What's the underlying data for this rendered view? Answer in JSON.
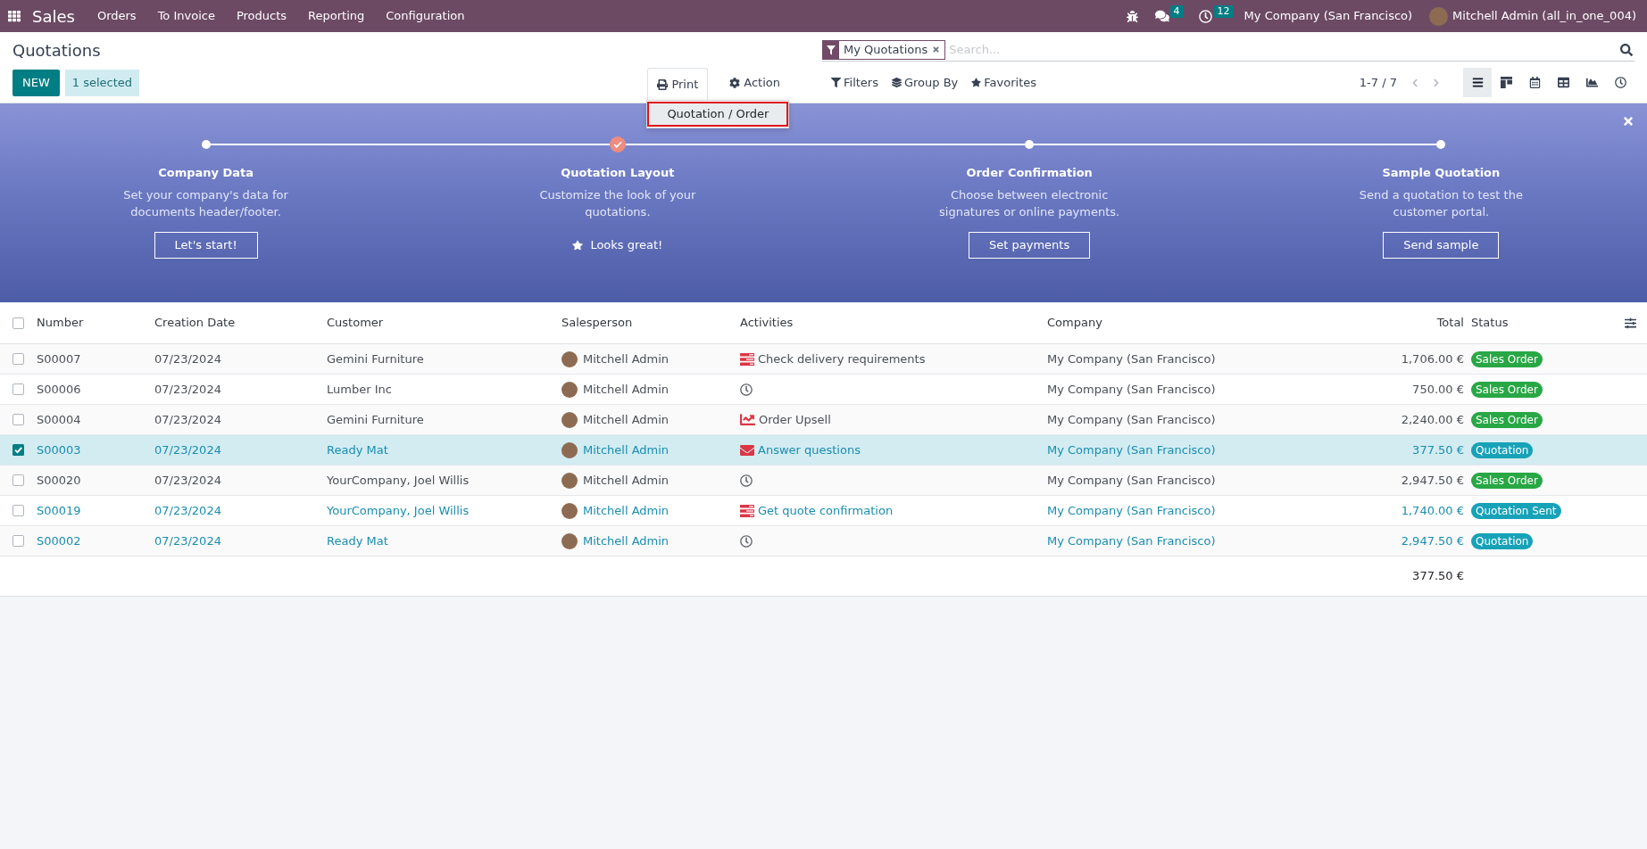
{
  "navbar": {
    "app_name": "Sales",
    "menu": [
      "Orders",
      "To Invoice",
      "Products",
      "Reporting",
      "Configuration"
    ],
    "systray": [
      {
        "kind": "bug"
      },
      {
        "kind": "chat",
        "badge": "4"
      },
      {
        "kind": "activity",
        "badge": "12"
      }
    ],
    "company": "My Company (San Francisco)",
    "user": "Mitchell Admin (all_in_one_004)"
  },
  "control_panel": {
    "title": "Quotations",
    "new_button": "NEW",
    "selection": "1 selected",
    "print_menu": {
      "label": "Print",
      "open": true,
      "items": [
        {
          "label": "Quotation / Order",
          "selected": true
        }
      ]
    },
    "action_menu": {
      "label": "Action"
    },
    "search": {
      "facets": [
        {
          "label": "My Quotations"
        }
      ],
      "placeholder": "Search..."
    },
    "filters": [
      {
        "kind": "filter",
        "label": "Filters"
      },
      {
        "kind": "group",
        "label": "Group By"
      },
      {
        "kind": "favorite",
        "label": "Favorites"
      }
    ],
    "pager": "1-7 / 7",
    "views": [
      {
        "kind": "list",
        "selected": true
      },
      {
        "kind": "kanban",
        "selected": false
      },
      {
        "kind": "calendar",
        "selected": false
      },
      {
        "kind": "pivot",
        "selected": false
      },
      {
        "kind": "graph",
        "selected": false
      },
      {
        "kind": "activity",
        "selected": false
      }
    ]
  },
  "banner": {
    "steps": [
      {
        "title": "Company Data",
        "description": [
          "Set your company's data for",
          "documents header/footer."
        ],
        "done": false,
        "action": "Let's start!"
      },
      {
        "title": "Quotation Layout",
        "description": [
          "Customize the look of your",
          "quotations."
        ],
        "done": true,
        "action": "Looks great!"
      },
      {
        "title": "Order Confirmation",
        "description": [
          "Choose between electronic",
          "signatures or online payments."
        ],
        "done": false,
        "action": "Set payments"
      },
      {
        "title": "Sample Quotation",
        "description": [
          "Send a quotation to test the",
          "customer portal."
        ],
        "done": false,
        "action": "Send sample"
      }
    ]
  },
  "table": {
    "all_selected": false,
    "columns": [
      "Number",
      "Creation Date",
      "Customer",
      "Salesperson",
      "Activities",
      "Company",
      "Total",
      "Status"
    ],
    "rows": [
      {
        "selected": false,
        "highlighted": false,
        "number": "S00007",
        "date": "07/23/2024",
        "customer": "Gemini Furniture",
        "salesperson": "Mitchell Admin",
        "activity": {
          "kind": "todo",
          "text": "Check delivery requirements"
        },
        "company": "My Company (San Francisco)",
        "total": "1,706.00 €",
        "status": {
          "label": "Sales Order",
          "color": "#28a745"
        }
      },
      {
        "selected": false,
        "highlighted": false,
        "number": "S00006",
        "date": "07/23/2024",
        "customer": "Lumber Inc",
        "salesperson": "Mitchell Admin",
        "activity": {
          "kind": "none"
        },
        "company": "My Company (San Francisco)",
        "total": "750.00 €",
        "status": {
          "label": "Sales Order",
          "color": "#28a745"
        }
      },
      {
        "selected": false,
        "highlighted": false,
        "number": "S00004",
        "date": "07/23/2024",
        "customer": "Gemini Furniture",
        "salesperson": "Mitchell Admin",
        "activity": {
          "kind": "upsell",
          "text": "Order Upsell"
        },
        "company": "My Company (San Francisco)",
        "total": "2,240.00 €",
        "status": {
          "label": "Sales Order",
          "color": "#28a745"
        }
      },
      {
        "selected": true,
        "highlighted": true,
        "number": "S00003",
        "date": "07/23/2024",
        "customer": "Ready Mat",
        "salesperson": "Mitchell Admin",
        "activity": {
          "kind": "email",
          "text": "Answer questions"
        },
        "company": "My Company (San Francisco)",
        "total": "377.50 €",
        "status": {
          "label": "Quotation",
          "color": "#17a2b8"
        }
      },
      {
        "selected": false,
        "highlighted": false,
        "number": "S00020",
        "date": "07/23/2024",
        "customer": "YourCompany, Joel Willis",
        "salesperson": "Mitchell Admin",
        "activity": {
          "kind": "none"
        },
        "company": "My Company (San Francisco)",
        "total": "2,947.50 €",
        "status": {
          "label": "Sales Order",
          "color": "#28a745"
        }
      },
      {
        "selected": false,
        "highlighted": true,
        "number": "S00019",
        "date": "07/23/2024",
        "customer": "YourCompany, Joel Willis",
        "salesperson": "Mitchell Admin",
        "activity": {
          "kind": "todo",
          "text": "Get quote confirmation"
        },
        "company": "My Company (San Francisco)",
        "total": "1,740.00 €",
        "status": {
          "label": "Quotation Sent",
          "color": "#17a2b8"
        }
      },
      {
        "selected": false,
        "highlighted": true,
        "number": "S00002",
        "date": "07/23/2024",
        "customer": "Ready Mat",
        "salesperson": "Mitchell Admin",
        "activity": {
          "kind": "none"
        },
        "company": "My Company (San Francisco)",
        "total": "2,947.50 €",
        "status": {
          "label": "Quotation",
          "color": "#17a2b8"
        }
      }
    ],
    "footer_total": "377.50 €"
  }
}
